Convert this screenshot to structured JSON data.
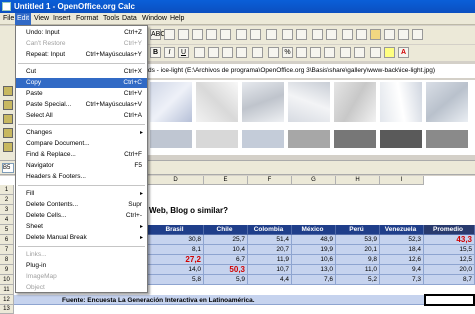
{
  "window": {
    "title": "Untitled 1 - OpenOffice.org Calc"
  },
  "menubar": [
    "File",
    "Edit",
    "View",
    "Insert",
    "Format",
    "Tools",
    "Data",
    "Window",
    "Help"
  ],
  "edit_menu": {
    "items": [
      {
        "label": "Undo: Input",
        "shortcut": "Ctrl+Z",
        "disabled": false
      },
      {
        "label": "Can't Restore",
        "shortcut": "Ctrl+Y",
        "disabled": true
      },
      {
        "label": "Repeat: Input",
        "shortcut": "Ctrl+Mayúsculas+Y",
        "disabled": false
      },
      {
        "label": "Cut",
        "shortcut": "Ctrl+X",
        "disabled": false
      },
      {
        "label": "Copy",
        "shortcut": "Ctrl+C",
        "disabled": false,
        "highlighted": true
      },
      {
        "label": "Paste",
        "shortcut": "Ctrl+V",
        "disabled": false
      },
      {
        "label": "Paste Special...",
        "shortcut": "Ctrl+Mayúsculas+V",
        "disabled": false
      },
      {
        "label": "Select All",
        "shortcut": "Ctrl+A",
        "disabled": false
      },
      {
        "label": "Changes",
        "submenu": true
      },
      {
        "label": "Compare Document...",
        "disabled": false
      },
      {
        "label": "Find & Replace...",
        "shortcut": "Ctrl+F",
        "disabled": false
      },
      {
        "label": "Navigator",
        "shortcut": "F5",
        "disabled": false
      },
      {
        "label": "Headers & Footers...",
        "disabled": false
      },
      {
        "label": "Fill",
        "submenu": true
      },
      {
        "label": "Delete Contents...",
        "shortcut": "Supr",
        "disabled": false
      },
      {
        "label": "Delete Cells...",
        "shortcut": "Ctrl+-",
        "disabled": false
      },
      {
        "label": "Sheet",
        "submenu": true
      },
      {
        "label": "Delete Manual Break",
        "submenu": true
      },
      {
        "label": "Links...",
        "disabled": true
      },
      {
        "label": "Plug-in",
        "disabled": false
      },
      {
        "label": "ImageMap",
        "disabled": true
      },
      {
        "label": "Object",
        "disabled": true
      }
    ]
  },
  "gallery": {
    "path": "ds - ice-light (E:\\Archivos de programa\\OpenOffice.org 3\\Basis\\share\\gallery\\www-back\\ice-light.jpg)"
  },
  "namebox": "B5",
  "sheet": {
    "columns": [
      "D",
      "E",
      "F",
      "G",
      "H",
      "I"
    ],
    "question": "Web, Blog o similar?",
    "headers": [
      "Brasil",
      "Chile",
      "Colombia",
      "México",
      "Perú",
      "Venezuela",
      "Promedio"
    ],
    "rows": [
      {
        "row": "6",
        "values": [
          "30,8",
          "25,7",
          "51,4",
          "48,9",
          "53,9",
          "52,3",
          "43,3"
        ]
      },
      {
        "row": "7",
        "values": [
          "8,1",
          "10,4",
          "20,7",
          "19,9",
          "20,1",
          "18,4",
          "15,5"
        ]
      },
      {
        "row": "8",
        "values": [
          "27,2",
          "6,7",
          "11,9",
          "10,6",
          "9,8",
          "12,6",
          "12,5"
        ]
      },
      {
        "row": "9",
        "values": [
          "14,0",
          "50,3",
          "10,7",
          "13,0",
          "11,0",
          "9,4",
          "20,0"
        ]
      },
      {
        "row": "10",
        "values": [
          "5,8",
          "5,9",
          "4,4",
          "7,6",
          "5,2",
          "7,3",
          "8,7"
        ]
      }
    ],
    "row_numbers": [
      "1",
      "2",
      "3",
      "4",
      "5",
      "6",
      "7",
      "8",
      "9",
      "10",
      "11",
      "12",
      "13"
    ],
    "source": "Fuente: Encuesta La Generación Interactiva en Latinoamérica."
  },
  "colors": {
    "accent": "#316ac5",
    "header": "#1f3e8a",
    "highlight_red": "#d10000"
  }
}
